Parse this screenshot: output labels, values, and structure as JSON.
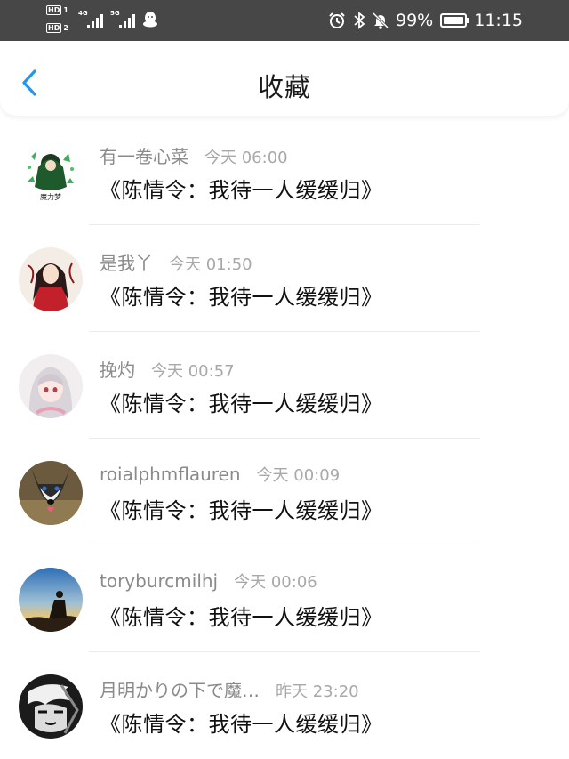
{
  "status_bar": {
    "hd1": "HD",
    "hd1_num": "1",
    "hd2": "HD",
    "hd2_num": "2",
    "net1": "4G",
    "net2": "5G",
    "battery_percent": "99%",
    "battery_level": 0.99,
    "time": "11:15",
    "icons": [
      "alarm-icon",
      "bluetooth-icon",
      "mute-bell-icon",
      "battery-icon",
      "qq-icon"
    ]
  },
  "header": {
    "title": "收藏",
    "back_icon": "chevron-left-icon",
    "accent_color": "#2196f3"
  },
  "items": [
    {
      "name": "有一卷心菜",
      "time": "今天 06:00",
      "message": "《陈情令：我待一人缓缓归》",
      "avatar_caption": "魔力梦"
    },
    {
      "name": "是我丫",
      "time": "今天 01:50",
      "message": "《陈情令：我待一人缓缓归》"
    },
    {
      "name": "挽灼",
      "time": "今天 00:57",
      "message": "《陈情令：我待一人缓缓归》"
    },
    {
      "name": "roialphmflauren",
      "time": "今天 00:09",
      "message": "《陈情令：我待一人缓缓归》"
    },
    {
      "name": "toryburcmilhj",
      "time": "今天 00:06",
      "message": "《陈情令：我待一人缓缓归》"
    },
    {
      "name": "月明かりの下で魔…",
      "time": "昨天 23:20",
      "message": "《陈情令：我待一人缓缓归》"
    }
  ]
}
